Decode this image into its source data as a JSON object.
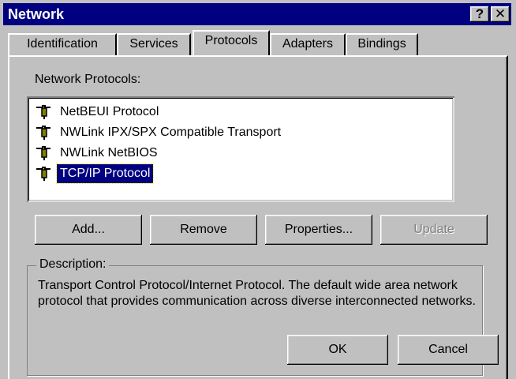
{
  "window": {
    "title": "Network"
  },
  "titlebar": {
    "help_label": "?",
    "close_label": "✕"
  },
  "tabs": [
    {
      "label": "Identification"
    },
    {
      "label": "Services"
    },
    {
      "label": "Protocols",
      "active": true
    },
    {
      "label": "Adapters"
    },
    {
      "label": "Bindings"
    }
  ],
  "protocols": {
    "label": "Network Protocols:",
    "items": [
      {
        "label": "NetBEUI Protocol",
        "icon": "network-protocol-icon"
      },
      {
        "label": "NWLink IPX/SPX Compatible Transport",
        "icon": "network-protocol-icon"
      },
      {
        "label": "NWLink NetBIOS",
        "icon": "network-protocol-icon"
      },
      {
        "label": "TCP/IP Protocol",
        "icon": "network-protocol-icon",
        "selected": true
      }
    ]
  },
  "buttons": {
    "add": "Add...",
    "remove": "Remove",
    "properties": "Properties...",
    "update": "Update"
  },
  "description": {
    "title": "Description:",
    "text": "Transport Control Protocol/Internet Protocol. The default wide area network protocol that provides communication across diverse interconnected networks."
  },
  "footer": {
    "ok": "OK",
    "cancel": "Cancel"
  },
  "colors": {
    "titlebar": "#000080",
    "face": "#c0c0c0",
    "selection": "#000080"
  }
}
